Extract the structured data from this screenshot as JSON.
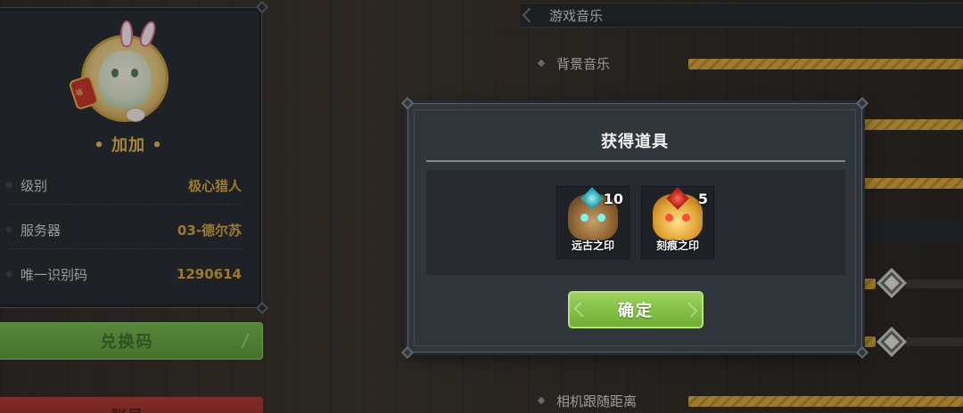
{
  "profile": {
    "nickname": "• 加加 •",
    "avatar_lantern_text": "福",
    "rows": [
      {
        "label": "级别",
        "value": "极心猎人"
      },
      {
        "label": "服务器",
        "value": "03-德尔苏"
      },
      {
        "label": "唯一识别码",
        "value": "1290614"
      }
    ],
    "redeem_label": "兑换码",
    "red_button_label": "账号"
  },
  "settings": {
    "section_title": "游戏音乐",
    "rows": [
      {
        "label": "背景音乐",
        "level": 1.0
      },
      {
        "label": "相机跟随距离",
        "level": 1.0
      }
    ]
  },
  "modal": {
    "title": "获得道具",
    "items": [
      {
        "name": "远古之印",
        "count": "10",
        "icon": "ancient-seal-icon"
      },
      {
        "name": "刻痕之印",
        "count": "5",
        "icon": "scar-seal-icon"
      }
    ],
    "confirm_label": "确定"
  },
  "colors": {
    "accent_gold": "#d6a23e",
    "confirm_green": "#7fbe43",
    "redeem_green": "#68a945",
    "panel_bg": "#262b31"
  }
}
